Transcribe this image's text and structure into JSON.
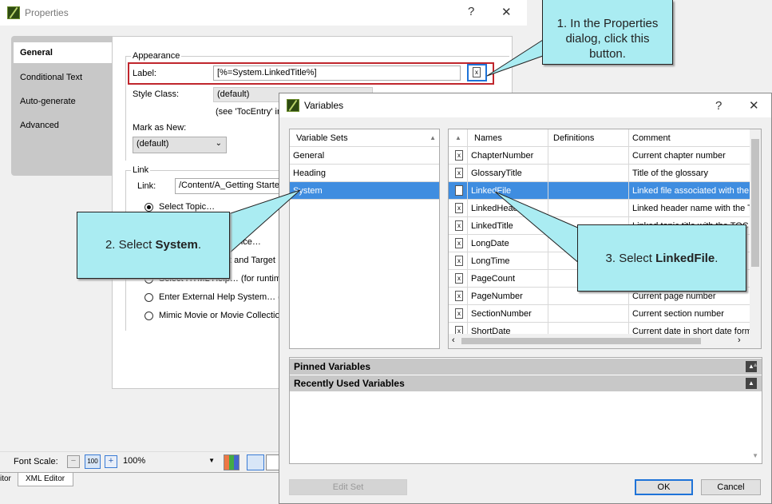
{
  "properties": {
    "title": "Properties",
    "help": "?",
    "close": "✕",
    "tabs": [
      "General",
      "Conditional Text",
      "Auto-generate",
      "Advanced"
    ],
    "appearance": {
      "group": "Appearance",
      "label_caption": "Label:",
      "label_value": "[%=System.LinkedTitle%]",
      "style_class_caption": "Style Class:",
      "style_class_value": "(default)",
      "style_hint": "(see 'TocEntry' in",
      "mark_as_new_caption": "Mark as New:",
      "mark_as_new_value": "(default)"
    },
    "link": {
      "group": "Link",
      "link_caption": "Link:",
      "link_value": "/Content/A_Getting Starte",
      "options": [
        "Select Topic…",
        "ance…",
        "t and Target",
        "Select HTML Help… (for runtim",
        "Enter External Help System… (",
        "Mimic Movie or Movie Collection"
      ]
    }
  },
  "bottom": {
    "font_scale": "Font Scale:",
    "zoom": "100%",
    "tab_left": "itor",
    "tab_xml": "XML Editor"
  },
  "variables": {
    "title": "Variables",
    "help": "?",
    "close": "✕",
    "sets_header": "Variable Sets",
    "sets": [
      "General",
      "Heading",
      "System"
    ],
    "columns": [
      "Names",
      "Definitions",
      "Comment"
    ],
    "rows": [
      {
        "name": "ChapterNumber",
        "def": "",
        "comment": "Current chapter number"
      },
      {
        "name": "GlossaryTitle",
        "def": "",
        "comment": "Title of the glossary"
      },
      {
        "name": "LinkedFile",
        "def": "",
        "comment": "Linked file associated with the T"
      },
      {
        "name": "LinkedHeader",
        "def": "",
        "comment": "Linked header name with the T"
      },
      {
        "name": "LinkedTitle",
        "def": "",
        "comment": "Linked topic title with the TOC l"
      },
      {
        "name": "LongDate",
        "def": "",
        "comment": ""
      },
      {
        "name": "LongTime",
        "def": "",
        "comment": ""
      },
      {
        "name": "PageCount",
        "def": "",
        "comment": ""
      },
      {
        "name": "PageNumber",
        "def": "",
        "comment": "Current page number"
      },
      {
        "name": "SectionNumber",
        "def": "",
        "comment": "Current section number"
      },
      {
        "name": "ShortDate",
        "def": "",
        "comment": "Current date in short date form"
      }
    ],
    "pinned": "Pinned Variables",
    "recent": "Recently Used Variables",
    "edit_set": "Edit Set",
    "ok": "OK",
    "cancel": "Cancel"
  },
  "callouts": {
    "c1": "1. In the Properties dialog, click this button.",
    "c2_pre": "2. Select ",
    "c2_bold": "System",
    "c2_post": ".",
    "c3_pre": "3. Select ",
    "c3_bold": "LinkedFile",
    "c3_post": "."
  },
  "colors": {
    "callout": "#aaecf2",
    "selection": "#3f8de0",
    "highlight_border": "#c0262d",
    "focus_border": "#1e73d8"
  }
}
